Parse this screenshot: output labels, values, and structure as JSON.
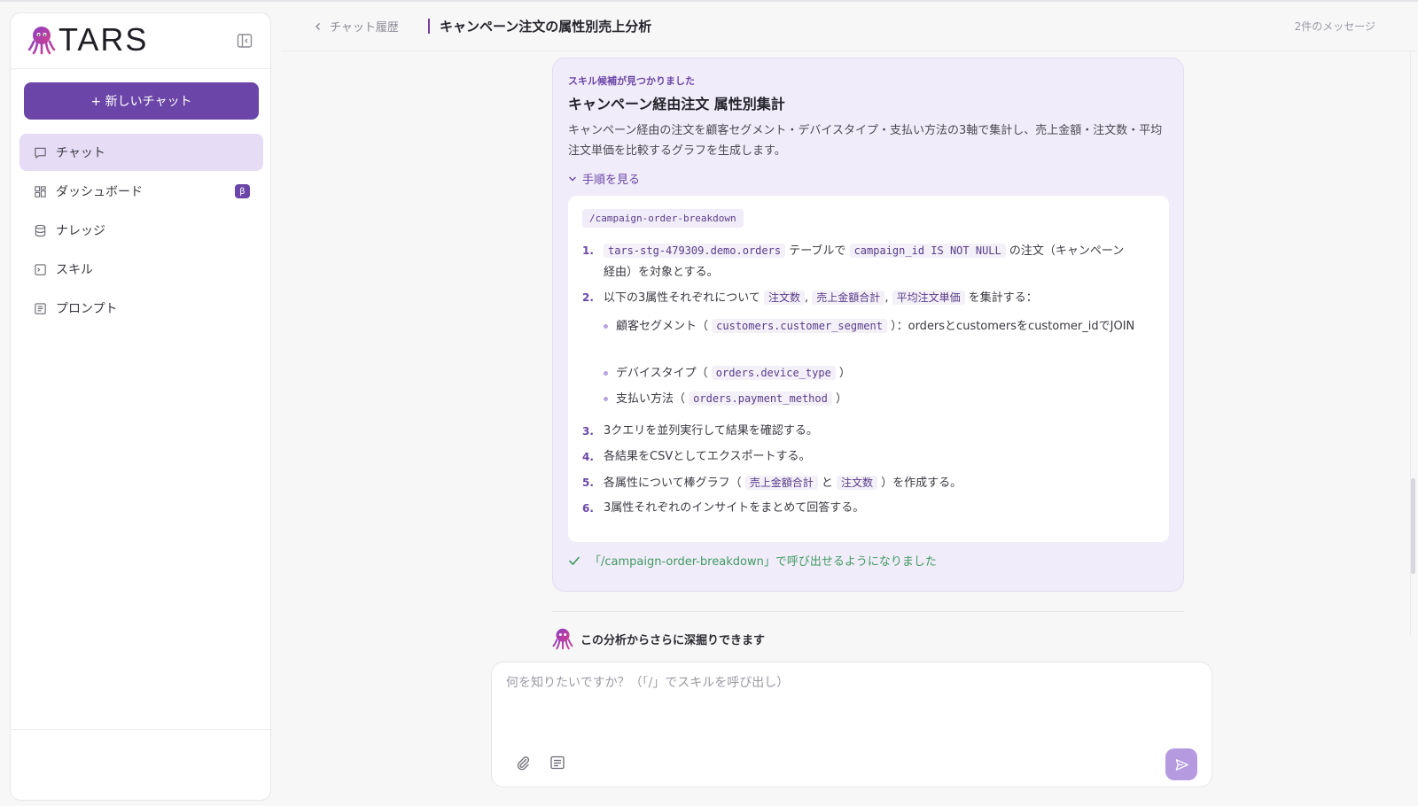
{
  "app": {
    "logo_text": "TARS"
  },
  "sidebar": {
    "new_chat_label": "+ 新しいチャット",
    "items": [
      {
        "label": "チャット",
        "icon": "chat-bubble-icon",
        "active": true
      },
      {
        "label": "ダッシュボード",
        "icon": "dashboard-grid-icon",
        "badge": "β"
      },
      {
        "label": "ナレッジ",
        "icon": "database-icon"
      },
      {
        "label": "スキル",
        "icon": "terminal-icon"
      },
      {
        "label": "プロンプト",
        "icon": "document-lines-icon"
      }
    ]
  },
  "header": {
    "back_label": "チャット履歴",
    "title": "キャンペーン注文の属性別売上分析",
    "message_count": "2件のメッセージ"
  },
  "skill_card": {
    "label": "スキル候補が見つかりました",
    "title": "キャンペーン経由注文 属性別集計",
    "description": "キャンペーン経由の注文を顧客セグメント・デバイスタイプ・支払い方法の3軸で集計し、売上金額・注文数・平均注文単価を比較するグラフを生成します。",
    "toggle_label": "手順を見る",
    "command": "/campaign-order-breakdown",
    "steps": {
      "s1": {
        "num": "1.",
        "code1": "tars-stg-479309.demo.orders",
        "text1": " テーブルで ",
        "code2": "campaign_id IS NOT NULL",
        "text2": " の注文（キャンペーン経由）を対象とする。"
      },
      "s2": {
        "num": "2.",
        "text1": "以下の3属性それぞれについて ",
        "m1": "注文数",
        "sep1": ", ",
        "m2": "売上金額合計",
        "sep2": ", ",
        "m3": "平均注文単価",
        "text2": " を集計する："
      },
      "b1": {
        "text1": "顧客セグメント（ ",
        "code": "customers.customer_segment",
        "text2": " ）：ordersとcustomersをcustomer_idでJOIN"
      },
      "b2": {
        "text1": "デバイスタイプ（ ",
        "code": "orders.device_type",
        "text2": " ）"
      },
      "b3": {
        "text1": "支払い方法（ ",
        "code": "orders.payment_method",
        "text2": " ）"
      },
      "s3": {
        "num": "3.",
        "text": "3クエリを並列実行して結果を確認する。"
      },
      "s4": {
        "num": "4.",
        "text": "各結果をCSVとしてエクスポートする。"
      },
      "s5": {
        "num": "5.",
        "text1": "各属性について棒グラフ（ ",
        "m1": "売上金額合計",
        "text2": " と ",
        "m2": "注文数",
        "text3": " ）を作成する。"
      },
      "s6": {
        "num": "6.",
        "text": "3属性それぞれのインサイトをまとめて回答する。"
      }
    },
    "success_text": "「/campaign-order-breakdown」で呼び出せるようになりました"
  },
  "assistant": {
    "text": "この分析からさらに深掘りできます"
  },
  "composer": {
    "placeholder": "何を知りたいですか？（「/」でスキルを呼び出し）"
  },
  "colors": {
    "accent": "#6b46a8",
    "active_bg": "#e6dcf6",
    "card_bg": "#f1ecf9",
    "success": "#3f9a62",
    "send_bg": "#b59ae0"
  }
}
